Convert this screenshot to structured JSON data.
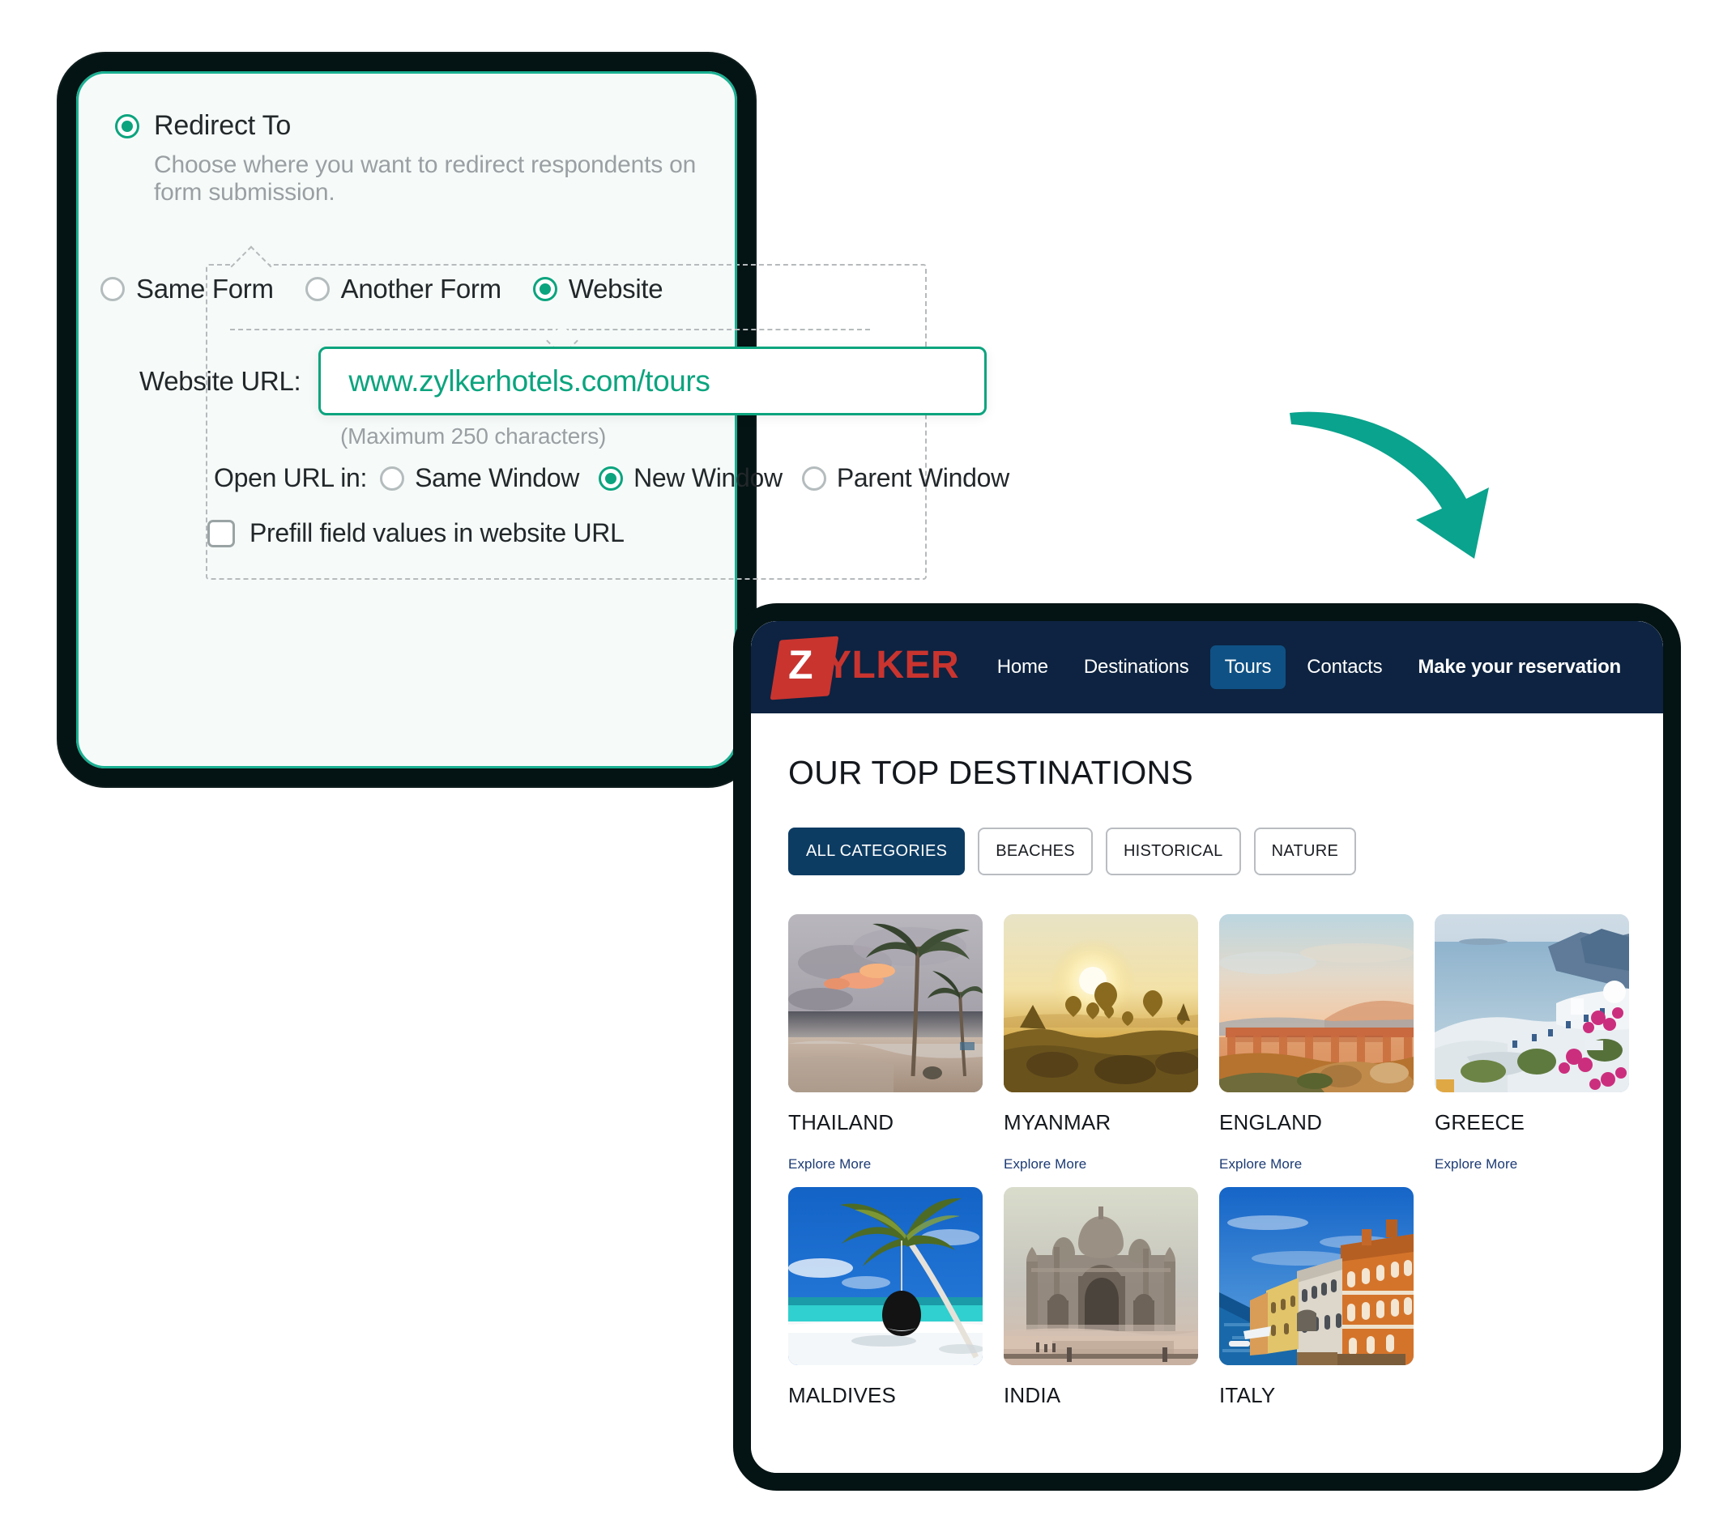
{
  "form": {
    "redirect": {
      "label": "Redirect To",
      "description": "Choose where you want to redirect respondents on form submission.",
      "selected": true
    },
    "mode_options": [
      {
        "label": "Same Form",
        "selected": false
      },
      {
        "label": "Another Form",
        "selected": false
      },
      {
        "label": "Website",
        "selected": true
      }
    ],
    "url_field": {
      "label": "Website URL:",
      "value": "www.zylkerhotels.com/tours",
      "hint": "(Maximum 250 characters)",
      "accent_color": "#0ba47e"
    },
    "open_url": {
      "label": "Open URL in:",
      "options": [
        {
          "label": "Same Window",
          "selected": false
        },
        {
          "label": "New Window",
          "selected": true
        },
        {
          "label": "Parent Window",
          "selected": false
        }
      ]
    },
    "prefill": {
      "label": "Prefill field values in website URL",
      "checked": false
    }
  },
  "arrow": {
    "color": "#0aa38d"
  },
  "site": {
    "logo": {
      "initial": "Z",
      "text": "YLKER",
      "mark_color": "#c9342f",
      "nav_bg": "#0d2341"
    },
    "nav": [
      {
        "label": "Home",
        "active": false,
        "bold": false
      },
      {
        "label": "Destinations",
        "active": false,
        "bold": false
      },
      {
        "label": "Tours",
        "active": true,
        "bold": false
      },
      {
        "label": "Contacts",
        "active": false,
        "bold": false
      },
      {
        "label": "Make your reservation",
        "active": false,
        "bold": true
      }
    ],
    "page_title": "OUR TOP DESTINATIONS",
    "categories": [
      {
        "label": "ALL CATEGORIES",
        "active": true
      },
      {
        "label": "BEACHES",
        "active": false
      },
      {
        "label": "HISTORICAL",
        "active": false
      },
      {
        "label": "NATURE",
        "active": false
      }
    ],
    "link_label": "Explore More",
    "destinations": [
      {
        "name": "THAILAND",
        "link": "Explore More",
        "scene": "thailand"
      },
      {
        "name": "MYANMAR",
        "link": "Explore More",
        "scene": "myanmar"
      },
      {
        "name": "ENGLAND",
        "link": "Explore More",
        "scene": "england"
      },
      {
        "name": "GREECE",
        "link": "Explore More",
        "scene": "greece"
      },
      {
        "name": "MALDIVES",
        "link": "",
        "scene": "maldives"
      },
      {
        "name": "INDIA",
        "link": "",
        "scene": "india"
      },
      {
        "name": "ITALY",
        "link": "",
        "scene": "italy"
      }
    ]
  }
}
